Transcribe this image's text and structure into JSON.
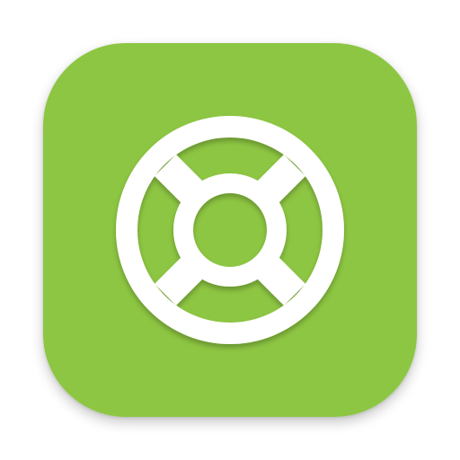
{
  "app_icon": {
    "name": "lifebuoy-icon",
    "background_color": "#8dc642",
    "glyph_color": "#ffffff",
    "glyph_shadow_color": "#4f7a1e"
  }
}
